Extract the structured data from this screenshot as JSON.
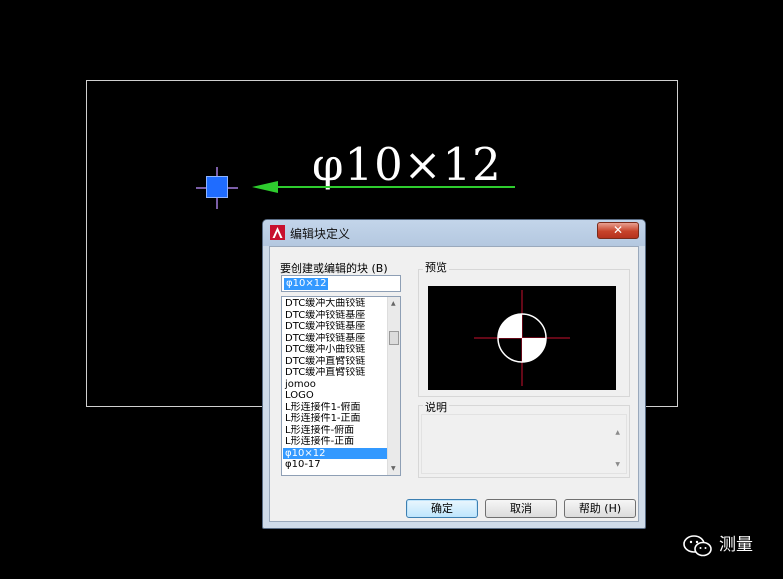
{
  "drawing": {
    "annotation_text": "φ10×12"
  },
  "dialog": {
    "title": "编辑块定义",
    "close_label": "✕",
    "block_label": "要创建或编辑的块 (B)",
    "block_name_value": "φ10×12",
    "block_list": [
      "DTC缓冲大曲铰链",
      "DTC缓冲铰链基座",
      "DTC缓冲铰链基座",
      "DTC缓冲铰链基座",
      "DTC缓冲小曲铰链",
      "DTC缓冲直臂铰链",
      "DTC缓冲直臂铰链",
      "jomoo",
      "LOGO",
      "L形连接件1-俯面",
      "L形连接件1-正面",
      "L形连接件-俯面",
      "L形连接件-正面",
      "φ10×12",
      "φ10-17"
    ],
    "selected_index": 13,
    "preview_label": "预览",
    "description_label": "说明",
    "ok_label": "确定",
    "cancel_label": "取消",
    "help_label": "帮助 (H)"
  },
  "watermark": {
    "text": "测量"
  }
}
